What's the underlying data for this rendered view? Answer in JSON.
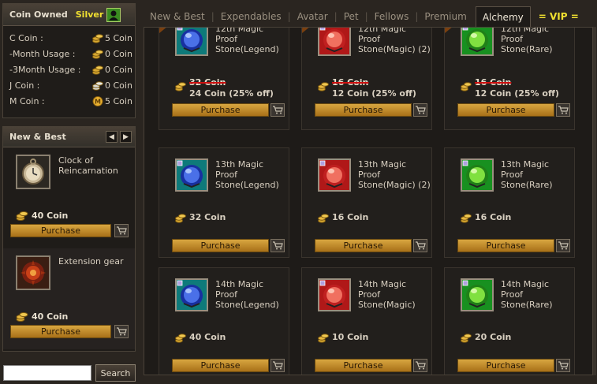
{
  "coin_panel": {
    "title": "Coin Owned",
    "tier": "Silver",
    "rows": [
      {
        "label": "C Coin :",
        "value": "5 Coin",
        "icon": "coin-stack-icon"
      },
      {
        "label": "-Month Usage :",
        "value": "0 Coin",
        "icon": "coin-stack-icon"
      },
      {
        "label": "-3Month Usage :",
        "value": "0 Coin",
        "icon": "coin-stack-icon"
      },
      {
        "label": "J Coin :",
        "value": "0 Coin",
        "icon": "coin-stack-silver-icon"
      },
      {
        "label": "M Coin :",
        "value": "5 Coin",
        "icon": "m-coin-icon"
      }
    ]
  },
  "new_best": {
    "title": "New & Best",
    "items": [
      {
        "name": "Clock of Reincarnation",
        "price": "40 Coin",
        "button": "Purchase"
      },
      {
        "name": "Extension gear",
        "price": "40 Coin",
        "button": "Purchase"
      }
    ]
  },
  "search": {
    "placeholder": "",
    "button": "Search"
  },
  "tabs": {
    "items": [
      "New & Best",
      "Expendables",
      "Avatar",
      "Pet",
      "Fellows",
      "Premium"
    ],
    "active": "Alchemy",
    "vip": "= VIP ="
  },
  "products": [
    {
      "name": "12th Magic Proof Stone(Legend)",
      "old_price": "32 Coin",
      "price": "24 Coin (25% off)",
      "sale": true,
      "stone": "blue",
      "button": "Purchase"
    },
    {
      "name": "12th Magic Proof Stone(Magic) (2)",
      "old_price": "16 Coin",
      "price": "12 Coin (25% off)",
      "sale": true,
      "stone": "red",
      "button": "Purchase"
    },
    {
      "name": "12th Magic Proof Stone(Rare)",
      "old_price": "16 Coin",
      "price": "12 Coin (25% off)",
      "sale": true,
      "stone": "green",
      "button": "Purchase"
    },
    {
      "name": "13th Magic Proof Stone(Legend)",
      "old_price": "",
      "price": "32 Coin",
      "sale": false,
      "stone": "blue",
      "button": "Purchase"
    },
    {
      "name": "13th Magic Proof Stone(Magic) (2)",
      "old_price": "",
      "price": "16 Coin",
      "sale": false,
      "stone": "red",
      "button": "Purchase"
    },
    {
      "name": "13th Magic Proof Stone(Rare)",
      "old_price": "",
      "price": "16 Coin",
      "sale": false,
      "stone": "green",
      "button": "Purchase"
    },
    {
      "name": "14th Magic Proof Stone(Legend)",
      "old_price": "",
      "price": "40 Coin",
      "sale": false,
      "stone": "blue",
      "button": "Purchase"
    },
    {
      "name": "14th Magic Proof Stone(Magic)",
      "old_price": "",
      "price": "10 Coin",
      "sale": false,
      "stone": "red",
      "button": "Purchase"
    },
    {
      "name": "14th Magic Proof Stone(Rare)",
      "old_price": "",
      "price": "20 Coin",
      "sale": false,
      "stone": "green",
      "button": "Purchase"
    }
  ],
  "sale_badge": "SALE",
  "colors": {
    "accent": "#f0e030",
    "button": "#c8902c",
    "sale_strike": "#d01010"
  }
}
